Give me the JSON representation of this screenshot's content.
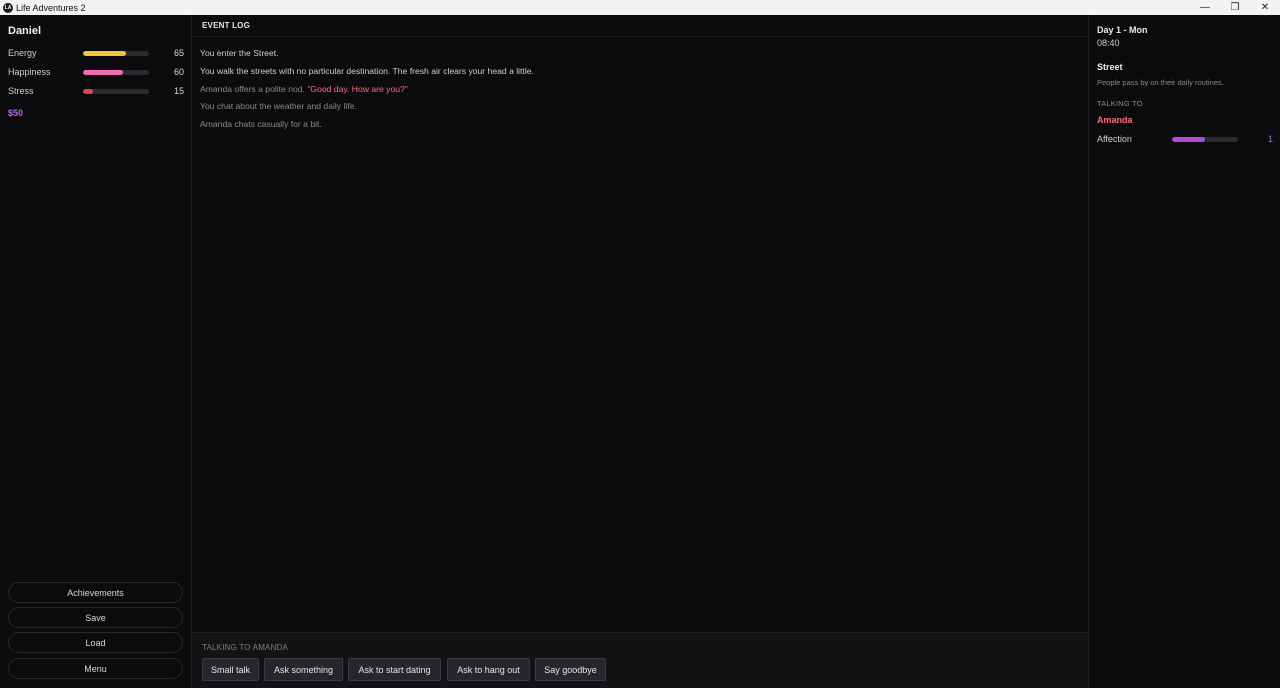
{
  "window": {
    "title": "Life Adventures 2",
    "icon": "app-logo-icon"
  },
  "player": {
    "name": "Daniel",
    "stats": [
      {
        "label": "Energy",
        "value": "65",
        "fill_fraction": 0.65,
        "color": "#f2c73a"
      },
      {
        "label": "Happiness",
        "value": "60",
        "fill_fraction": 0.6,
        "color": "#f06bb1"
      },
      {
        "label": "Stress",
        "value": "15",
        "fill_fraction": 0.15,
        "color": "#e3434c"
      }
    ],
    "money": "$50"
  },
  "menu": {
    "achievements": "Achievements",
    "save": "Save",
    "load": "Load",
    "menu": "Menu"
  },
  "log": {
    "header": "EVENT LOG",
    "lines": [
      {
        "text": "You enter the Street."
      },
      {
        "text": "You walk the streets with no particular destination. The fresh air clears your head a little."
      },
      {
        "text": "Amanda offers a polite nod. ",
        "quote": "\"Good day. How are you?\""
      },
      {
        "text": "You chat about the weather and daily life."
      },
      {
        "text": "Amanda chats casually for a bit."
      }
    ]
  },
  "actions": {
    "talking_label": "TALKING TO AMANDA",
    "buttons": [
      "Small talk",
      "Ask something",
      "Ask to start dating",
      "Ask to hang out",
      "Say goodbye"
    ]
  },
  "info": {
    "day": "Day 1 - Mon",
    "time": "08:40",
    "location": "Street",
    "location_desc": "People pass by on their daily routines.",
    "talking_to_header": "TALKING TO",
    "npc_name": "Amanda",
    "affection_label": "Affection",
    "affection_value": "1",
    "affection_fraction": 0.5,
    "affection_color": "#b54ad9"
  }
}
